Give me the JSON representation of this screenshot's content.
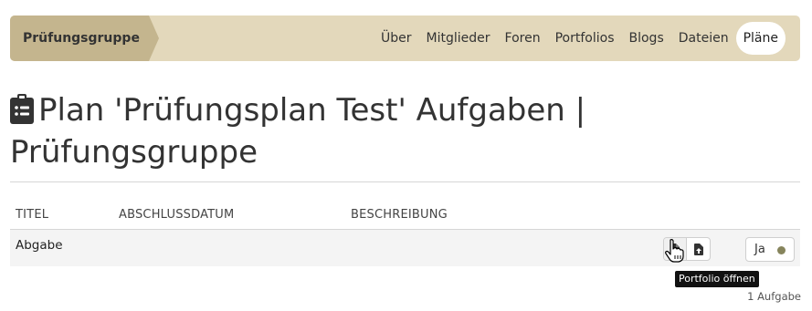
{
  "group": {
    "title": "Prüfungsgruppe",
    "bar_color": "#e3d8bb",
    "chevron_color": "#c4b58e",
    "nav": [
      {
        "label": "Über",
        "active": false
      },
      {
        "label": "Mitglieder",
        "active": false
      },
      {
        "label": "Foren",
        "active": false
      },
      {
        "label": "Portfolios",
        "active": false
      },
      {
        "label": "Blogs",
        "active": false
      },
      {
        "label": "Dateien",
        "active": false
      },
      {
        "label": "Pläne",
        "active": true
      }
    ]
  },
  "heading": {
    "icon": "clipboard-list-icon",
    "text": "Plan 'Prüfungsplan Test' Aufgaben | Prüfungsgruppe"
  },
  "table": {
    "columns": [
      "TITEL",
      "ABSCHLUSSDATUM",
      "BESCHREIBUNG"
    ],
    "rows": [
      {
        "title": "Abgabe",
        "date": "",
        "description": "",
        "actions": [
          "file-icon",
          "file-upload-icon"
        ],
        "status_label": "Ja",
        "status_color": "#86845c"
      }
    ]
  },
  "tooltip": "Portfolio öffnen",
  "count": "1 Aufgabe"
}
